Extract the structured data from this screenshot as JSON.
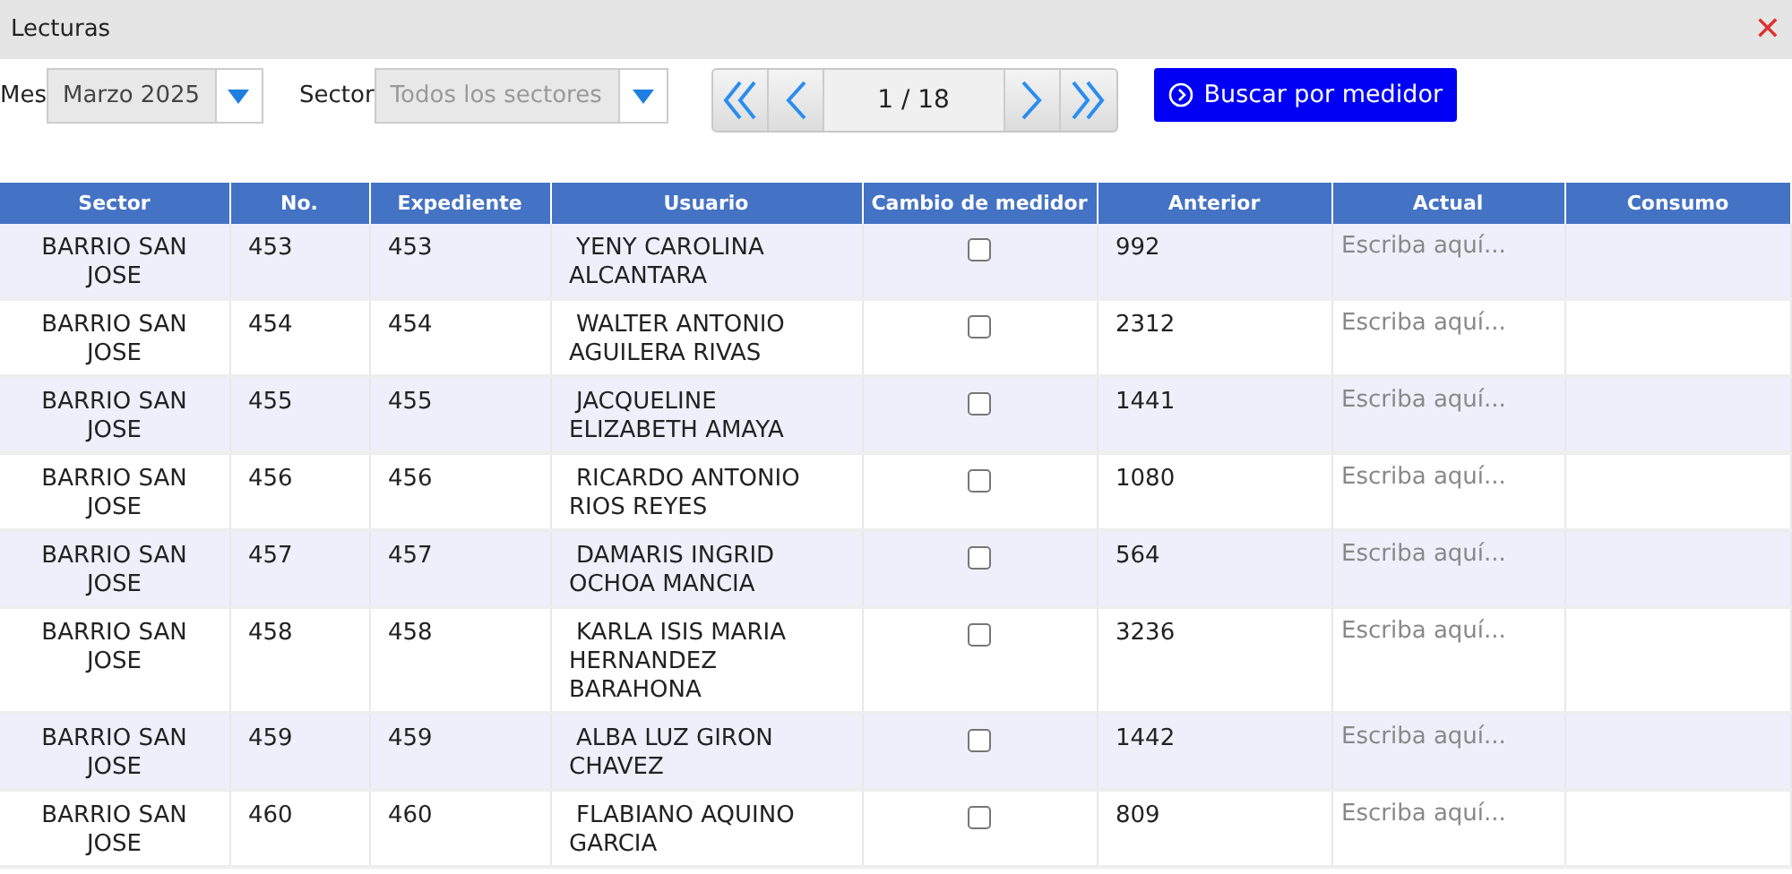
{
  "window": {
    "title": "Lecturas",
    "close": "✕"
  },
  "filters": {
    "month": {
      "label": "Mes",
      "value": "Marzo 2025",
      "disabled": false
    },
    "sector": {
      "label": "Sector",
      "value": "Todos los sectores",
      "disabled": true
    }
  },
  "pager": {
    "text": "1 / 18"
  },
  "search_button": {
    "label": "Buscar por medidor"
  },
  "table": {
    "columns": [
      "Sector",
      "No.",
      "Expediente",
      "Usuario",
      "Cambio de medidor",
      "Anterior",
      "Actual",
      "Consumo"
    ],
    "rows": [
      {
        "sector": "BARRIO SAN JOSE",
        "no": "453",
        "expediente": "453",
        "usuario": "YENY CAROLINA ALCANTARA",
        "cambio": false,
        "anterior": "992",
        "actual_placeholder": "Escriba aquí..."
      },
      {
        "sector": "BARRIO SAN JOSE",
        "no": "454",
        "expediente": "454",
        "usuario": "WALTER ANTONIO AGUILERA RIVAS",
        "cambio": false,
        "anterior": "2312",
        "actual_placeholder": "Escriba aquí..."
      },
      {
        "sector": "BARRIO SAN JOSE",
        "no": "455",
        "expediente": "455",
        "usuario": "JACQUELINE ELIZABETH AMAYA",
        "cambio": false,
        "anterior": "1441",
        "actual_placeholder": "Escriba aquí..."
      },
      {
        "sector": "BARRIO SAN JOSE",
        "no": "456",
        "expediente": "456",
        "usuario": "RICARDO ANTONIO RIOS REYES",
        "cambio": false,
        "anterior": "1080",
        "actual_placeholder": "Escriba aquí..."
      },
      {
        "sector": "BARRIO SAN JOSE",
        "no": "457",
        "expediente": "457",
        "usuario": "DAMARIS INGRID OCHOA MANCIA",
        "cambio": false,
        "anterior": "564",
        "actual_placeholder": "Escriba aquí..."
      },
      {
        "sector": "BARRIO SAN JOSE",
        "no": "458",
        "expediente": "458",
        "usuario": "KARLA ISIS MARIA HERNANDEZ BARAHONA",
        "cambio": false,
        "anterior": "3236",
        "actual_placeholder": "Escriba aquí..."
      },
      {
        "sector": "BARRIO SAN JOSE",
        "no": "459",
        "expediente": "459",
        "usuario": "ALBA LUZ GIRON CHAVEZ",
        "cambio": false,
        "anterior": "1442",
        "actual_placeholder": "Escriba aquí..."
      },
      {
        "sector": "BARRIO SAN JOSE",
        "no": "460",
        "expediente": "460",
        "usuario": "FLABIANO AQUINO GARCIA",
        "cambio": false,
        "anterior": "809",
        "actual_placeholder": "Escriba aquí..."
      }
    ]
  }
}
